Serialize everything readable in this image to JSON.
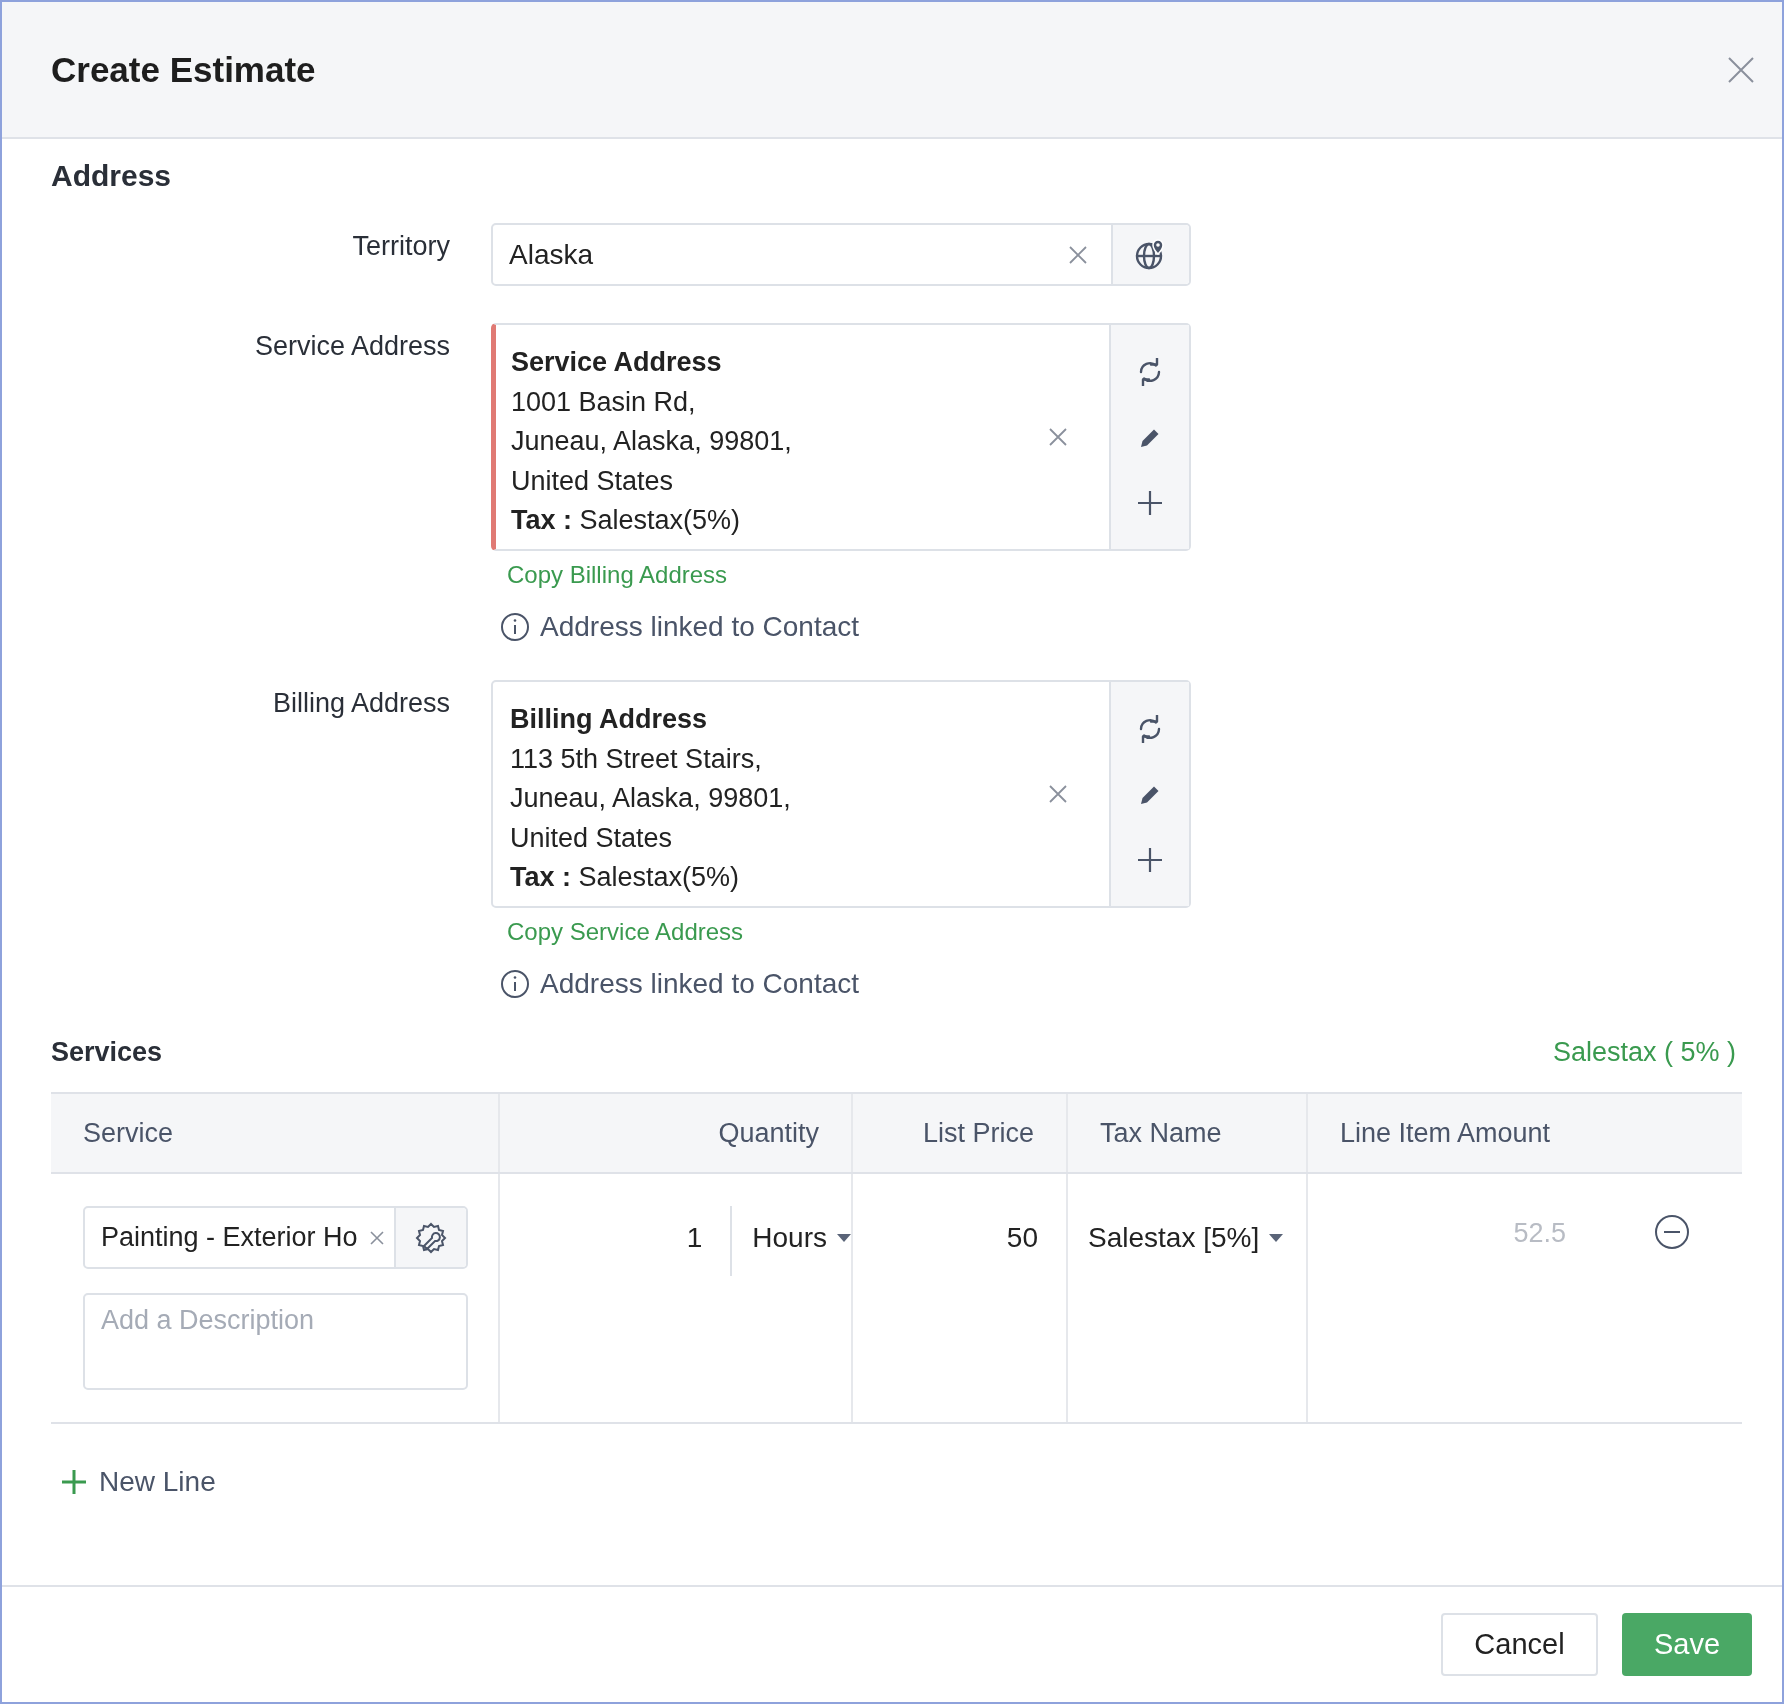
{
  "dialog": {
    "title": "Create Estimate"
  },
  "address": {
    "heading": "Address",
    "territory": {
      "label": "Territory",
      "value": "Alaska"
    },
    "addresses": [
      {
        "label": "Service Address",
        "title": "Service Address",
        "lines": [
          "1001 Basin Rd,",
          "Juneau, Alaska, 99801,",
          "United States"
        ],
        "tax": "**Tax :** Salestax(5%)",
        "error": true,
        "copy_link": "Copy Billing Address",
        "note": "Address linked to Contact"
      },
      {
        "label": "Billing Address",
        "title": "Billing Address",
        "lines": [
          "113 5th Street Stairs,",
          "Juneau, Alaska, 99801,",
          "United States"
        ],
        "tax": "**Tax :** Salestax(5%)",
        "error": false,
        "copy_link": "Copy Service Address",
        "note": "Address linked to Contact"
      }
    ]
  },
  "services": {
    "heading": "Services",
    "tax_summary": "Salestax ( 5% )",
    "columns": [
      "Service",
      "Quantity",
      "List Price",
      "Tax Name",
      "Line Item Amount"
    ],
    "rows": [
      {
        "service": "Painting - Exterior Ho",
        "description_placeholder": "Add a Description",
        "quantity": "1",
        "unit": "Hours",
        "list_price": "50",
        "tax": "Salestax [5%]",
        "amount": "52.5"
      }
    ],
    "new_line": "New Line"
  },
  "buttons": [
    {
      "label": "Cancel",
      "kind": "secondary"
    },
    {
      "label": "Save",
      "kind": "primary"
    }
  ]
}
